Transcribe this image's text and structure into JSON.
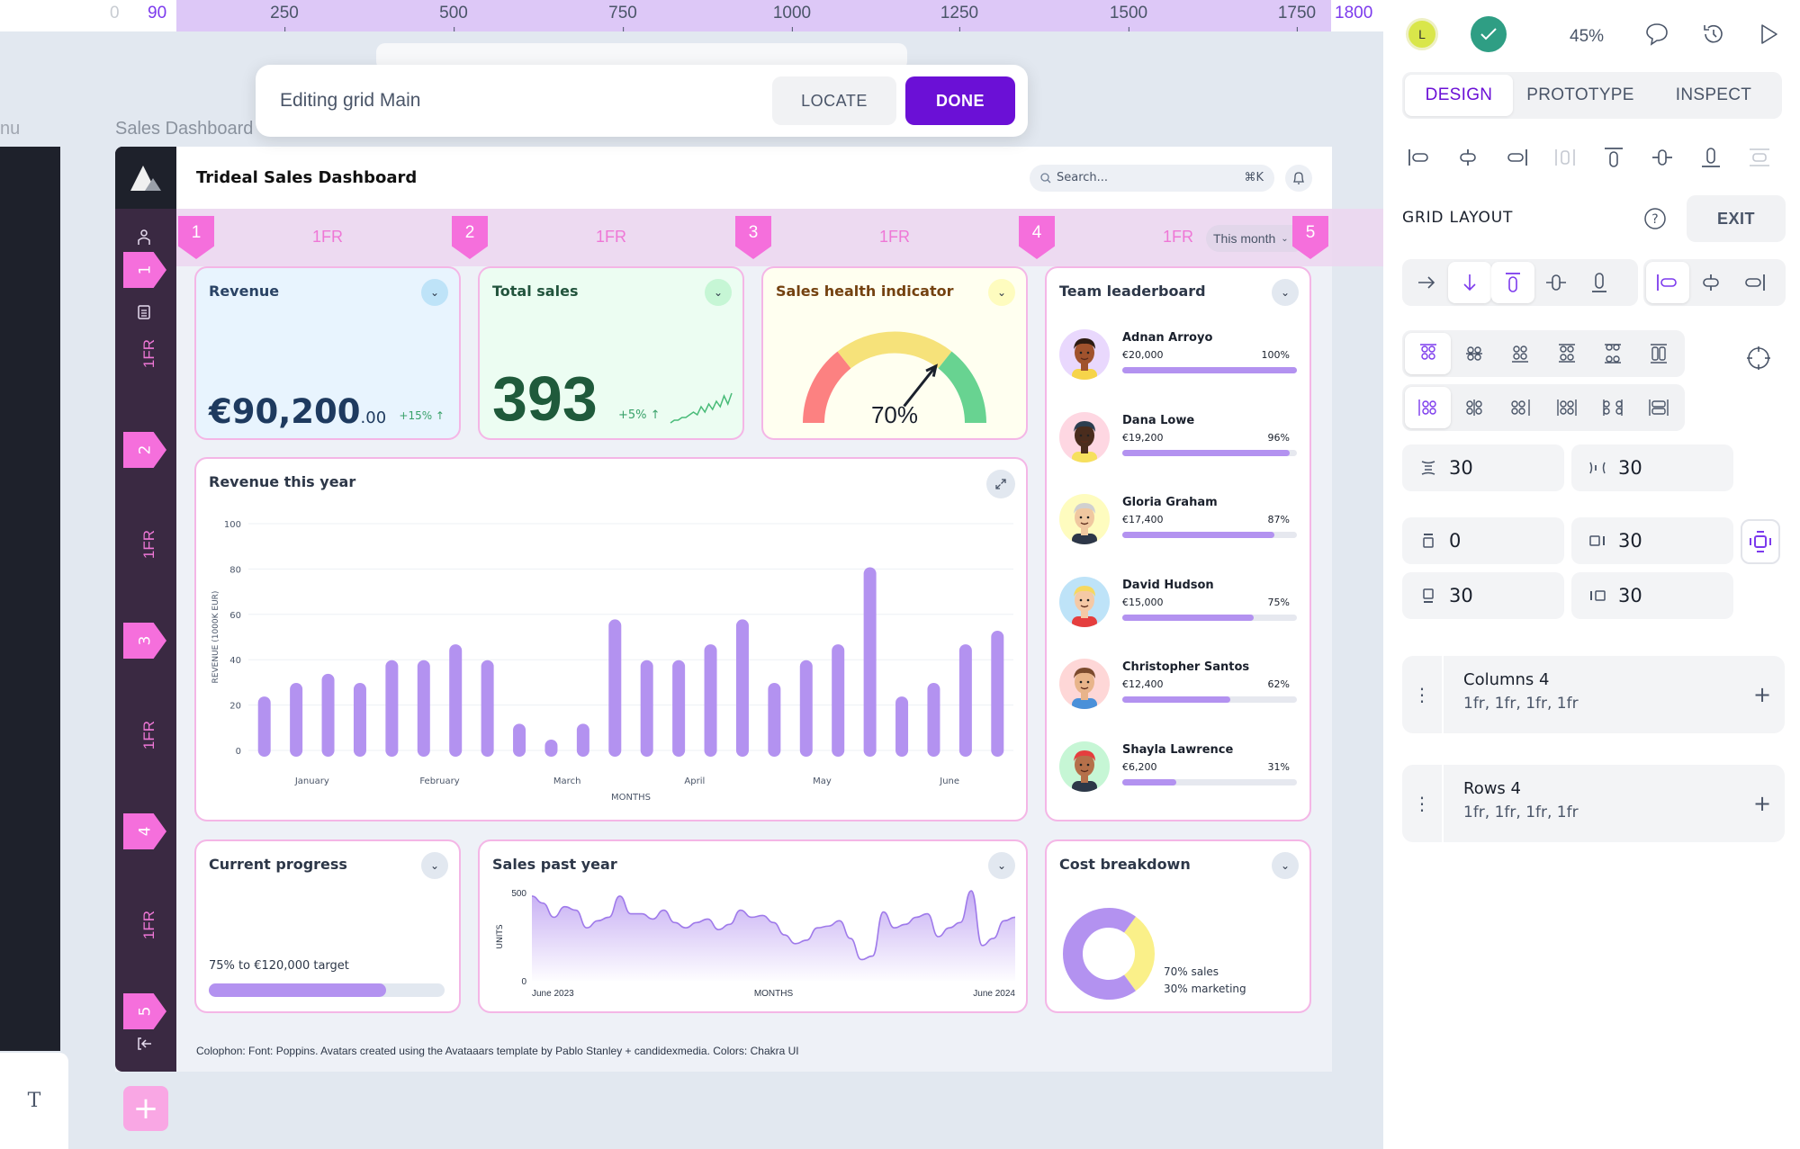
{
  "ruler": {
    "start_mark": "0",
    "left_edge": "90",
    "ticks": [
      "250",
      "500",
      "750",
      "1000",
      "1250",
      "1500",
      "1750"
    ],
    "right_edge": "1800"
  },
  "canvas": {
    "menu_label": "nu",
    "frame_label": "Sales Dashboard",
    "text_tool_glyph": "T"
  },
  "edit_bar": {
    "title": "Editing grid Main",
    "locate_label": "LOCATE",
    "done_label": "DONE"
  },
  "dashboard": {
    "title": "Trideal Sales Dashboard",
    "search_placeholder": "Search...",
    "search_shortcut": "⌘K",
    "period_select": "This month",
    "colophon": "Colophon: Font: Poppins. Avatars created using the Avataaars template by Pablo Stanley + candidexmedia. Colors: Chakra UI",
    "grid_columns": {
      "markers": [
        "1",
        "2",
        "3",
        "4",
        "5"
      ],
      "sizes": [
        "1FR",
        "1FR",
        "1FR",
        "1FR"
      ]
    },
    "grid_rows": {
      "markers": [
        "1",
        "2",
        "3",
        "4",
        "5"
      ],
      "sizes": [
        "1FR",
        "1FR",
        "1FR",
        "1FR"
      ]
    },
    "revenue": {
      "title": "Revenue",
      "value_main": "€90,200",
      "value_cents": ".00",
      "delta": "+15% ↑"
    },
    "total_sales": {
      "title": "Total sales",
      "value": "393",
      "delta": "+5% ↑"
    },
    "health": {
      "title": "Sales health indicator",
      "value": "70%",
      "value_fraction": 0.7
    },
    "leaderboard": {
      "title": "Team leaderboard",
      "members": [
        {
          "name": "Adnan Arroyo",
          "amount": "€20,000",
          "pct": "100%",
          "fraction": 1.0,
          "bg": "#e9d8fd",
          "skin": "#a0522d",
          "hair": "#2d1b12",
          "shirt": "#f6d44a"
        },
        {
          "name": "Dana Lowe",
          "amount": "€19,200",
          "pct": "96%",
          "fraction": 0.96,
          "bg": "#fed7e2",
          "skin": "#4a2c1d",
          "hair": "#2c3e50",
          "shirt": "#f6e05e"
        },
        {
          "name": "Gloria Graham",
          "amount": "€17,400",
          "pct": "87%",
          "fraction": 0.87,
          "bg": "#fefcbf",
          "skin": "#f0c8a0",
          "hair": "#d0d0d0",
          "shirt": "#2d3748"
        },
        {
          "name": "David Hudson",
          "amount": "€15,000",
          "pct": "75%",
          "fraction": 0.75,
          "bg": "#bee3f8",
          "skin": "#f5c9a5",
          "hair": "#f6d860",
          "shirt": "#e53e3e"
        },
        {
          "name": "Christopher Santos",
          "amount": "€12,400",
          "pct": "62%",
          "fraction": 0.62,
          "bg": "#fed7d7",
          "skin": "#e8b48a",
          "hair": "#7b4a2d",
          "shirt": "#4a90d9"
        },
        {
          "name": "Shayla Lawrence",
          "amount": "€6,200",
          "pct": "31%",
          "fraction": 0.31,
          "bg": "#c6f6d5",
          "skin": "#b5704a",
          "hair": "#e53e3e",
          "shirt": "#2d3748"
        }
      ]
    },
    "progress": {
      "title": "Current progress",
      "label": "75% to €120,000 target",
      "fraction": 0.75
    },
    "cost": {
      "title": "Cost breakdown",
      "legend": [
        "70% sales",
        "30% marketing"
      ]
    },
    "sales_past_year_title": "Sales past year",
    "revenue_year_title": "Revenue this year"
  },
  "chart_data": [
    {
      "type": "bar",
      "title": "Revenue this year",
      "xlabel": "MONTHS",
      "ylabel": "REVENUE (1000K EUR)",
      "ylim": [
        0,
        100
      ],
      "yticks": [
        0,
        20,
        40,
        60,
        80,
        100
      ],
      "grid": true,
      "month_labels": [
        "January",
        "February",
        "March",
        "April",
        "May",
        "June"
      ],
      "values": [
        21,
        27,
        31,
        27,
        37,
        37,
        44,
        37,
        9,
        2,
        9,
        55,
        37,
        37,
        44,
        55,
        27,
        37,
        44,
        78,
        21,
        27,
        44,
        50
      ],
      "color": "#b392f0"
    },
    {
      "type": "area",
      "title": "Sales past year",
      "xlabel": "MONTHS",
      "ylabel": "UNITS",
      "ylim": [
        0,
        500
      ],
      "yticks": [
        0,
        500
      ],
      "x_labels": [
        "June 2023",
        "June 2024"
      ],
      "values": [
        480,
        440,
        360,
        420,
        400,
        300,
        340,
        360,
        480,
        380,
        380,
        350,
        400,
        330,
        300,
        330,
        350,
        290,
        320,
        400,
        360,
        370,
        330,
        260,
        210,
        230,
        300,
        310,
        340,
        240,
        120,
        140,
        390,
        300,
        320,
        360,
        380,
        250,
        300,
        330,
        510,
        200,
        240,
        340,
        360
      ],
      "color": "#b392f0"
    },
    {
      "type": "pie",
      "title": "Cost breakdown",
      "categories": [
        "sales",
        "marketing"
      ],
      "values": [
        70,
        30
      ],
      "colors": [
        "#b392f0",
        "#faf089"
      ],
      "donut": true
    },
    {
      "type": "line",
      "title": "Total sales sparkline",
      "values": [
        2,
        3,
        3,
        4,
        4,
        5,
        6,
        5,
        8,
        6,
        9,
        7,
        10,
        8,
        12,
        9,
        13
      ],
      "color": "#48bb78"
    }
  ],
  "panel": {
    "user_initial": "L",
    "zoom": "45%",
    "tabs": [
      {
        "label": "DESIGN",
        "active": true
      },
      {
        "label": "PROTOTYPE",
        "active": false
      },
      {
        "label": "INSPECT",
        "active": false
      }
    ],
    "grid_layout_label": "GRID LAYOUT",
    "exit_label": "EXIT",
    "row_gap": "30",
    "column_gap": "30",
    "padding_top": "0",
    "padding_right": "30",
    "padding_bottom": "30",
    "padding_left": "30",
    "columns": {
      "title": "Columns 4",
      "values": "1fr, 1fr, 1fr, 1fr"
    },
    "rows": {
      "title": "Rows 4",
      "values": "1fr, 1fr, 1fr, 1fr"
    }
  }
}
